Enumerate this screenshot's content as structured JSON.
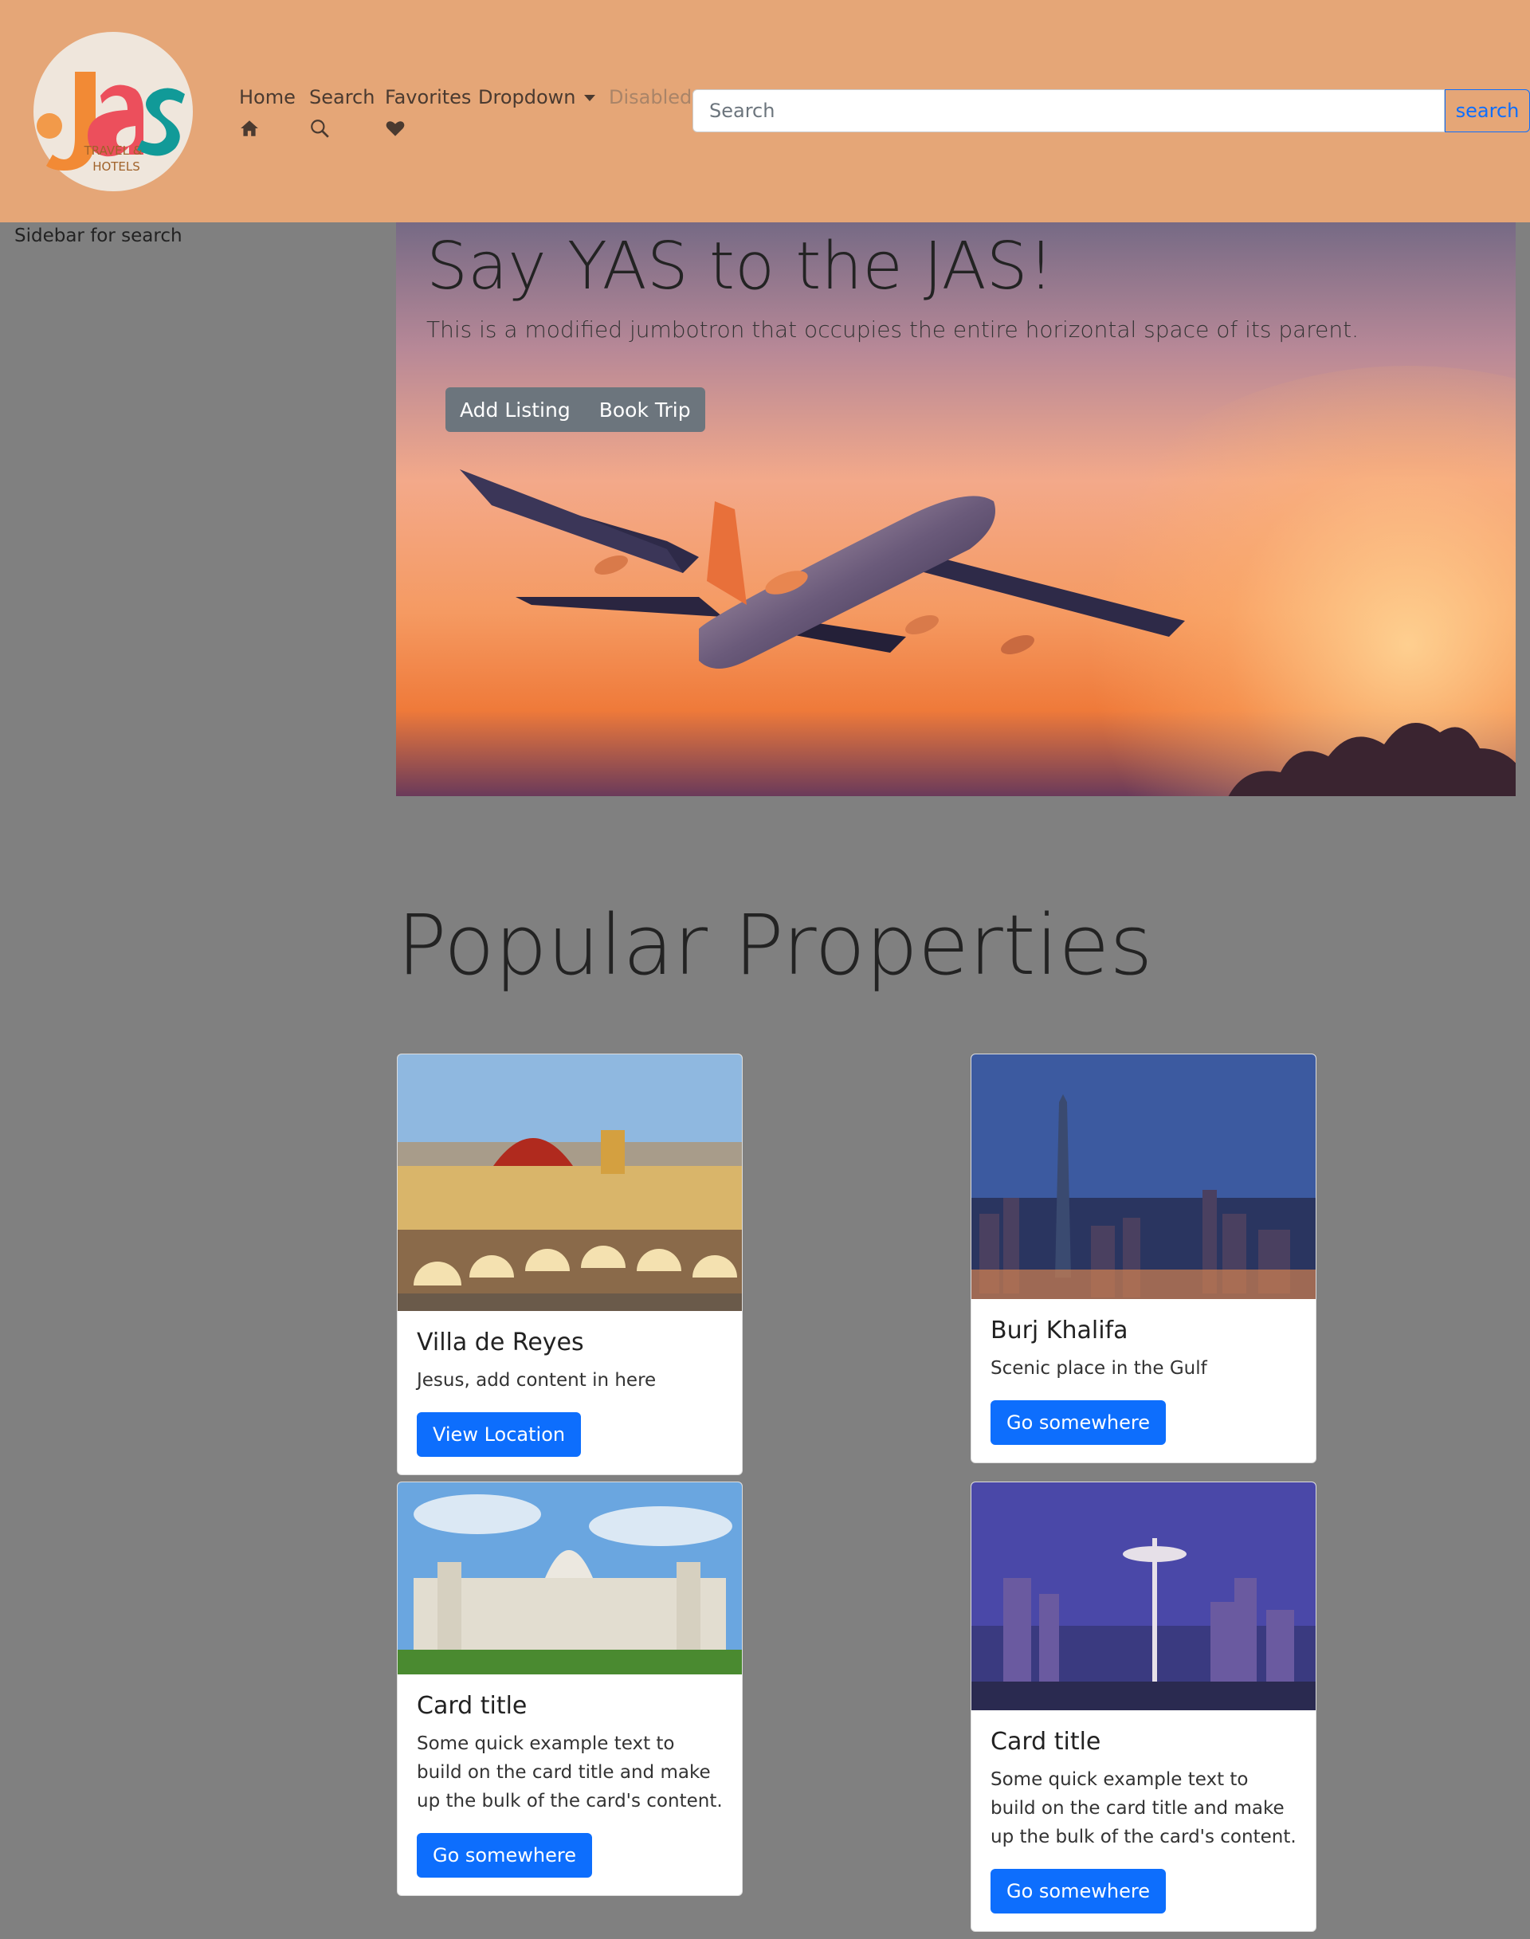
{
  "navbar": {
    "logo": {
      "text": "Jas",
      "tagline_1": "TRAVEL &",
      "tagline_2": "HOTELS"
    },
    "items": [
      {
        "label": "Home",
        "icon": "home-icon"
      },
      {
        "label": "Search",
        "icon": "search-icon"
      },
      {
        "label": "Favorites",
        "icon": "heart-icon"
      },
      {
        "label": "Dropdown"
      },
      {
        "label": "Disabled"
      }
    ],
    "search": {
      "placeholder": "Search",
      "button": "search"
    }
  },
  "sidebar": {
    "text": "Sidebar for search"
  },
  "hero": {
    "title": "Say YAS to the JAS!",
    "subtitle": "This is a modified jumbotron that occupies the entire horizontal space of its parent.",
    "buttons": [
      "Add Listing",
      "Book Trip"
    ]
  },
  "section": {
    "title": "Popular Properties"
  },
  "cards": [
    {
      "title": "Villa de Reyes",
      "text": "Jesus, add content in here",
      "button": "View Location"
    },
    {
      "title": "Burj Khalifa",
      "text": "Scenic place in the Gulf",
      "button": "Go somewhere"
    },
    {
      "title": "Card title",
      "text": "Some quick example text to build on the card title and make up the bulk of the card's content.",
      "button": "Go somewhere"
    },
    {
      "title": "Card title",
      "text": "Some quick example text to build on the card title and make up the bulk of the card's content.",
      "button": "Go somewhere"
    }
  ],
  "colors": {
    "navbar": "#e5a677",
    "page_bg": "#808080",
    "primary": "#0d6efd",
    "secondary": "#6c757d"
  }
}
